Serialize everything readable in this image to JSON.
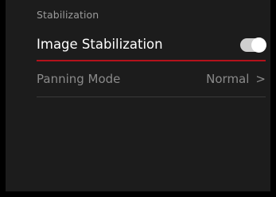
{
  "header": {
    "title": "Stabilization"
  },
  "menu": {
    "image_stabilization": {
      "label": "Image Stabilization",
      "toggle_state": "on"
    },
    "panning_mode": {
      "label": "Panning Mode",
      "value": "Normal",
      "chevron_icon": "chevron-right-icon"
    }
  },
  "colors": {
    "background": "#1c1c1c",
    "accent_red": "#b3121b",
    "toggle_track": "#cfcfcf",
    "toggle_knob": "#ffffff",
    "muted_text": "#8a8a8a"
  }
}
